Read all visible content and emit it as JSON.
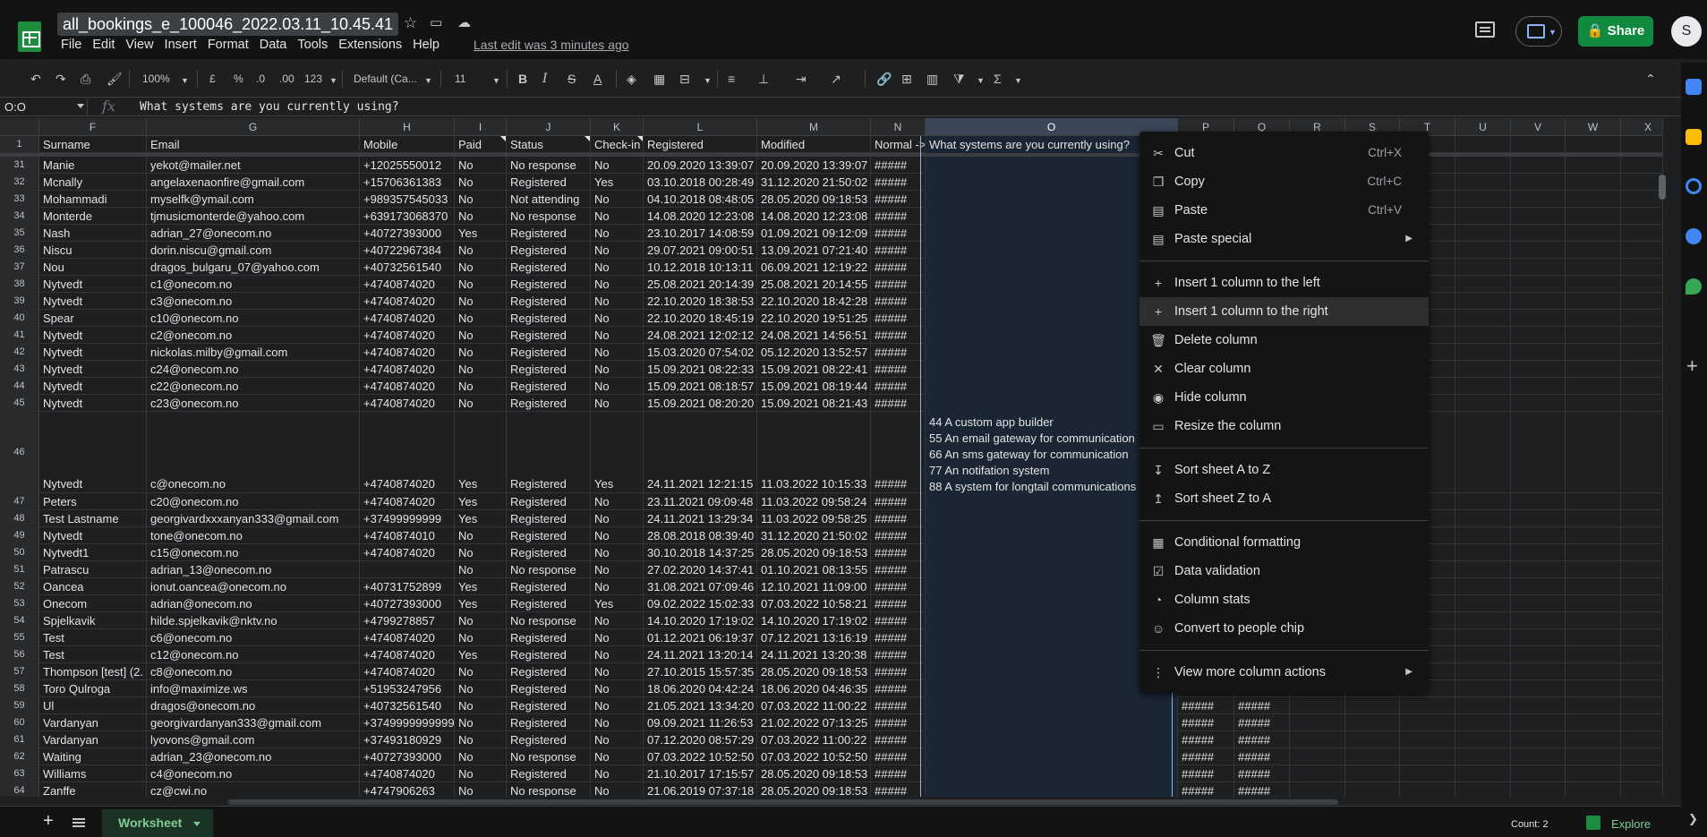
{
  "doc": {
    "title": "all_bookings_e_100046_2022.03.11_10.45.41",
    "last_edit": "Last edit was 3 minutes ago"
  },
  "menu": [
    "File",
    "Edit",
    "View",
    "Insert",
    "Format",
    "Data",
    "Tools",
    "Extensions",
    "Help"
  ],
  "header_right": {
    "share_label": "Share",
    "avatar_letter": "S"
  },
  "toolbar": {
    "zoom": "100%",
    "currency": "£",
    "percent": "%",
    "dec_less": ".0",
    "dec_more": ".00",
    "number_format": "123",
    "font": "Default (Ca...",
    "font_size": "11",
    "bold": "B",
    "italic": "I",
    "strike": "S",
    "text_color": "A"
  },
  "formula_bar": {
    "name_box": "O:O",
    "fx": "fx",
    "formula": "What systems are you currently using?"
  },
  "columns": [
    "F",
    "G",
    "H",
    "I",
    "J",
    "K",
    "L",
    "M",
    "N",
    "O",
    "P",
    "Q",
    "R",
    "S",
    "T",
    "U",
    "V",
    "W",
    "X"
  ],
  "selected_column": "O",
  "header_row": {
    "num": "1",
    "cells": [
      "Surname",
      "Email",
      "Mobile",
      "Paid",
      "Status",
      "Check-in",
      "Registered",
      "Modified",
      "Normal ->",
      "What systems are you currently using?"
    ]
  },
  "rows": [
    {
      "num": "31",
      "cells": [
        "Manie",
        "yekot@mailer.net",
        "+12025550012",
        "No",
        "No response",
        "No",
        "20.09.2020 13:39:07",
        "20.09.2020 13:39:07",
        "#####"
      ]
    },
    {
      "num": "32",
      "cells": [
        "Mcnally",
        "angelaxenaonfire@gmail.com",
        "+15706361383",
        "No",
        "Registered",
        "Yes",
        "03.10.2018 00:28:49",
        "31.12.2020 21:50:02",
        "#####"
      ]
    },
    {
      "num": "33",
      "cells": [
        "Mohammadi",
        "myselfk@ymail.com",
        "+989357545033",
        "No",
        "Not attending",
        "No",
        "04.10.2018 08:48:05",
        "28.05.2020 09:18:53",
        "#####"
      ]
    },
    {
      "num": "34",
      "cells": [
        "Monterde",
        "tjmusicmonterde@yahoo.com",
        "+639173068370",
        "No",
        "No response",
        "No",
        "14.08.2020 12:23:08",
        "14.08.2020 12:23:08",
        "#####"
      ]
    },
    {
      "num": "35",
      "cells": [
        "Nash",
        "adrian_27@onecom.no",
        "+40727393000",
        "Yes",
        "Registered",
        "No",
        "23.10.2017 14:08:59",
        "01.09.2021 09:12:09",
        "#####"
      ]
    },
    {
      "num": "36",
      "cells": [
        "Niscu",
        "dorin.niscu@gmail.com",
        "+40722967384",
        "No",
        "Registered",
        "No",
        "29.07.2021 09:00:51",
        "13.09.2021 07:21:40",
        "#####"
      ]
    },
    {
      "num": "37",
      "cells": [
        "Nou",
        "dragos_bulgaru_07@yahoo.com",
        "+40732561540",
        "No",
        "Registered",
        "No",
        "10.12.2018 10:13:11",
        "06.09.2021 12:19:22",
        "#####"
      ]
    },
    {
      "num": "38",
      "cells": [
        "Nytvedt",
        "c1@onecom.no",
        "+4740874020",
        "No",
        "Registered",
        "No",
        "25.08.2021 20:14:39",
        "25.08.2021 20:14:55",
        "#####"
      ]
    },
    {
      "num": "39",
      "cells": [
        "Nytvedt",
        "c3@onecom.no",
        "+4740874020",
        "No",
        "Registered",
        "No",
        "22.10.2020 18:38:53",
        "22.10.2020 18:42:28",
        "#####"
      ]
    },
    {
      "num": "40",
      "cells": [
        "Spear",
        "c10@onecom.no",
        "+4740874020",
        "No",
        "Registered",
        "No",
        "22.10.2020 18:45:19",
        "22.10.2020 19:51:25",
        "#####"
      ]
    },
    {
      "num": "41",
      "cells": [
        "Nytvedt",
        "c2@onecom.no",
        "+4740874020",
        "No",
        "Registered",
        "No",
        "24.08.2021 12:02:12",
        "24.08.2021 14:56:51",
        "#####"
      ]
    },
    {
      "num": "42",
      "cells": [
        "Nytvedt",
        "nickolas.milby@gmail.com",
        "+4740874020",
        "No",
        "Registered",
        "No",
        "15.03.2020 07:54:02",
        "05.12.2020 13:52:57",
        "#####"
      ]
    },
    {
      "num": "43",
      "cells": [
        "Nytvedt",
        "c24@onecom.no",
        "+4740874020",
        "No",
        "Registered",
        "No",
        "15.09.2021 08:22:33",
        "15.09.2021 08:22:41",
        "#####"
      ]
    },
    {
      "num": "44",
      "cells": [
        "Nytvedt",
        "c22@onecom.no",
        "+4740874020",
        "No",
        "Registered",
        "No",
        "15.09.2021 08:18:57",
        "15.09.2021 08:19:44",
        "#####"
      ]
    },
    {
      "num": "45",
      "cells": [
        "Nytvedt",
        "c23@onecom.no",
        "+4740874020",
        "No",
        "Registered",
        "No",
        "15.09.2021 08:20:20",
        "15.09.2021 08:21:43",
        "#####"
      ]
    },
    {
      "num": "46",
      "tall": true,
      "cells": [
        "Nytvedt",
        "c@onecom.no",
        "+4740874020",
        "Yes",
        "Registered",
        "Yes",
        "24.11.2021 12:21:15",
        "11.03.2022 10:15:33",
        "#####"
      ],
      "o_lines": [
        "44 A custom app builder",
        "55 An email gateway for communication",
        "66 An sms gateway for communication",
        "77 An notifation system",
        "88 A system for longtail communications"
      ]
    },
    {
      "num": "47",
      "cells": [
        "Peters",
        "c20@onecom.no",
        "+4740874020",
        "Yes",
        "Registered",
        "No",
        "23.11.2021 09:09:48",
        "11.03.2022 09:58:24",
        "#####"
      ]
    },
    {
      "num": "48",
      "cells": [
        "Test Lastname",
        "georgivardxxxanyan333@gmail.com",
        "+37499999999",
        "Yes",
        "Registered",
        "No",
        "24.11.2021 13:29:34",
        "11.03.2022 09:58:25",
        "#####"
      ]
    },
    {
      "num": "49",
      "cells": [
        "Nytvedt",
        "tone@onecom.no",
        "+4740874010",
        "No",
        "Registered",
        "No",
        "28.08.2018 08:39:40",
        "31.12.2020 21:50:02",
        "#####"
      ]
    },
    {
      "num": "50",
      "cells": [
        "Nytvedt1",
        "c15@onecom.no",
        "+4740874020",
        "No",
        "Registered",
        "No",
        "30.10.2018 14:37:25",
        "28.05.2020 09:18:53",
        "#####"
      ]
    },
    {
      "num": "51",
      "cells": [
        "Patrascu",
        "adrian_13@onecom.no",
        "",
        "No",
        "No response",
        "No",
        "27.02.2020 14:37:41",
        "01.10.2021 08:13:55",
        "#####"
      ]
    },
    {
      "num": "52",
      "cells": [
        "Oancea",
        "ionut.oancea@onecom.no",
        "+40731752899",
        "Yes",
        "Registered",
        "No",
        "31.08.2021 07:09:46",
        "12.10.2021 11:09:00",
        "#####"
      ]
    },
    {
      "num": "53",
      "cells": [
        "Onecom",
        "adrian@onecom.no",
        "+40727393000",
        "Yes",
        "Registered",
        "Yes",
        "09.02.2022 15:02:33",
        "07.03.2022 10:58:21",
        "#####"
      ]
    },
    {
      "num": "54",
      "cells": [
        "Spjelkavik",
        "hilde.spjelkavik@nktv.no",
        "+4799278857",
        "No",
        "No response",
        "No",
        "14.10.2020 17:19:02",
        "14.10.2020 17:19:02",
        "#####"
      ]
    },
    {
      "num": "55",
      "cells": [
        "Test",
        "c6@onecom.no",
        "+4740874020",
        "No",
        "Registered",
        "No",
        "01.12.2021 06:19:37",
        "07.12.2021 13:16:19",
        "#####"
      ]
    },
    {
      "num": "56",
      "cells": [
        "Test",
        "c12@onecom.no",
        "+4740874020",
        "Yes",
        "Registered",
        "No",
        "24.11.2021 13:20:14",
        "24.11.2021 13:20:38",
        "#####"
      ]
    },
    {
      "num": "57",
      "cells": [
        "Thompson [test] (2.",
        "c8@onecom.no",
        "+4740874020",
        "No",
        "Registered",
        "No",
        "27.10.2015 15:57:35",
        "28.05.2020 09:18:53",
        "#####"
      ]
    },
    {
      "num": "58",
      "cells": [
        "Toro Qulroga",
        "info@maximize.ws",
        "+51953247956",
        "No",
        "Registered",
        "No",
        "18.06.2020 04:42:24",
        "18.06.2020 04:46:35",
        "#####"
      ]
    },
    {
      "num": "59",
      "cells": [
        "Ul",
        "dragos@onecom.no",
        "+40732561540",
        "No",
        "Registered",
        "No",
        "21.05.2021 13:34:20",
        "07.03.2022 11:00:22",
        "#####"
      ],
      "pq": [
        "#####",
        "#####"
      ]
    },
    {
      "num": "60",
      "cells": [
        "Vardanyan",
        "georgivardanyan333@gmail.com",
        "+37499999999999",
        "No",
        "Registered",
        "No",
        "09.09.2021 11:26:53",
        "21.02.2022 07:13:25",
        "#####"
      ],
      "pq": [
        "#####",
        "#####"
      ]
    },
    {
      "num": "61",
      "cells": [
        "Vardanyan",
        "lyovons@gmail.com",
        "+37493180929",
        "No",
        "Registered",
        "No",
        "07.12.2020 08:57:29",
        "07.03.2022 11:00:22",
        "#####"
      ],
      "pq": [
        "#####",
        "#####"
      ]
    },
    {
      "num": "62",
      "cells": [
        "Waiting",
        "adrian_23@onecom.no",
        "+40727393000",
        "No",
        "No response",
        "No",
        "07.03.2022 10:52:50",
        "07.03.2022 10:52:50",
        "#####"
      ],
      "pq": [
        "#####",
        "#####"
      ]
    },
    {
      "num": "63",
      "cells": [
        "Williams",
        "c4@onecom.no",
        "+4740874020",
        "No",
        "Registered",
        "No",
        "21.10.2017 17:15:57",
        "28.05.2020 09:18:53",
        "#####"
      ],
      "pq": [
        "#####",
        "#####"
      ]
    },
    {
      "num": "64",
      "cells": [
        "Zanffe",
        "cz@cwi.no",
        "+4747906263",
        "No",
        "No response",
        "No",
        "21.06.2019 07:37:18",
        "28.05.2020 09:18:53",
        "#####"
      ],
      "pq": [
        "#####",
        "#####"
      ]
    }
  ],
  "context_menu": [
    {
      "name": "cut",
      "icon": "scissors-icon",
      "glyph": "✂",
      "label": "Cut",
      "shortcut": "Ctrl+X"
    },
    {
      "name": "copy",
      "icon": "copy-icon",
      "glyph": "❐",
      "label": "Copy",
      "shortcut": "Ctrl+C"
    },
    {
      "name": "paste",
      "icon": "clipboard-icon",
      "glyph": "▤",
      "label": "Paste",
      "shortcut": "Ctrl+V"
    },
    {
      "name": "paste-special",
      "icon": "clipboard-icon",
      "glyph": "▤",
      "label": "Paste special",
      "submenu": true
    },
    {
      "sep": true
    },
    {
      "name": "insert-left",
      "icon": "plus-icon",
      "glyph": "+",
      "label": "Insert 1 column to the left"
    },
    {
      "name": "insert-right",
      "icon": "plus-icon",
      "glyph": "+",
      "label": "Insert 1 column to the right",
      "highlight": true
    },
    {
      "name": "delete-column",
      "icon": "trash-icon",
      "glyph": "🗑",
      "label": "Delete column"
    },
    {
      "name": "clear-column",
      "icon": "close-icon",
      "glyph": "✕",
      "label": "Clear column"
    },
    {
      "name": "hide-column",
      "icon": "eye-off-icon",
      "glyph": "◉",
      "label": "Hide column"
    },
    {
      "name": "resize-column",
      "icon": "resize-icon",
      "glyph": "▭",
      "label": "Resize the column"
    },
    {
      "sep": true
    },
    {
      "name": "sort-az",
      "icon": "sort-az-icon",
      "glyph": "↧",
      "label": "Sort sheet A to Z"
    },
    {
      "name": "sort-za",
      "icon": "sort-za-icon",
      "glyph": "↥",
      "label": "Sort sheet Z to A"
    },
    {
      "sep": true
    },
    {
      "name": "conditional-formatting",
      "icon": "paint-roller-icon",
      "glyph": "▦",
      "label": "Conditional formatting"
    },
    {
      "name": "data-validation",
      "icon": "validation-icon",
      "glyph": "☑",
      "label": "Data validation"
    },
    {
      "name": "column-stats",
      "icon": "bulb-icon",
      "glyph": "◔",
      "label": "Column stats"
    },
    {
      "name": "people-chip",
      "icon": "person-chip-icon",
      "glyph": "☺",
      "label": "Convert to people chip"
    },
    {
      "sep": true
    },
    {
      "name": "more-actions",
      "icon": "more-vert-icon",
      "glyph": "⋮",
      "label": "View more column actions",
      "submenu": true
    }
  ],
  "bottom": {
    "sheet_name": "Worksheet",
    "count": "Count: 2",
    "explore": "Explore"
  }
}
